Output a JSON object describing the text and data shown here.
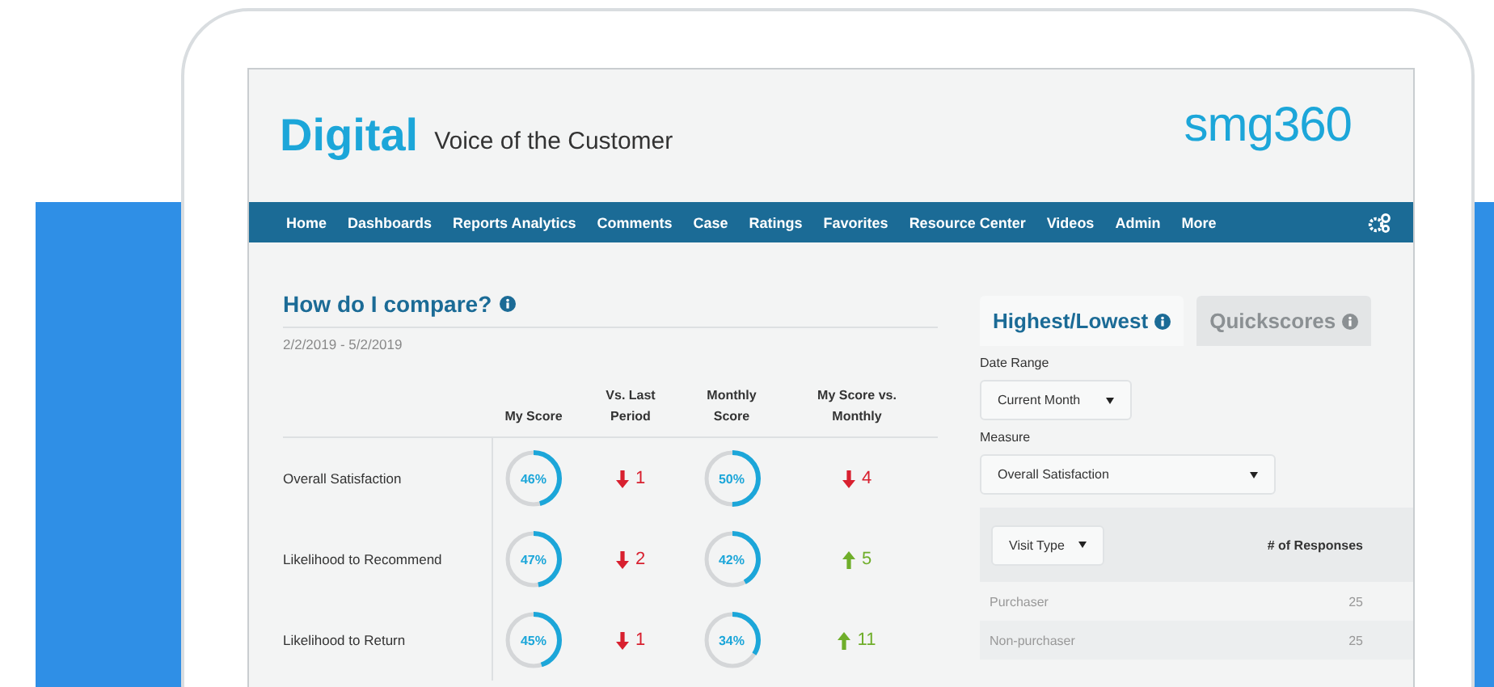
{
  "header": {
    "brand": "Digital",
    "subtitle": "Voice of the Customer",
    "logo": "smg360"
  },
  "nav": {
    "items": [
      "Home",
      "Dashboards",
      "Reports Analytics",
      "Comments",
      "Case",
      "Ratings",
      "Favorites",
      "Resource Center",
      "Videos",
      "Admin",
      "More"
    ]
  },
  "compare": {
    "title": "How do I compare?",
    "date_range": "2/2/2019 - 5/2/2019",
    "columns": [
      "My Score",
      "Vs. Last Period",
      "Monthly Score",
      "My Score vs. Monthly"
    ],
    "rows": [
      {
        "label": "Overall Satisfaction",
        "my_score": {
          "text": "46%",
          "level": 0.46
        },
        "vs_last": {
          "kind": "down",
          "text": "1"
        },
        "monthly": {
          "text": "50%",
          "level": 0.5
        },
        "vs_monthly": {
          "kind": "down",
          "text": "4"
        }
      },
      {
        "label": "Likelihood to Recommend",
        "my_score": {
          "text": "47%",
          "level": 0.47
        },
        "vs_last": {
          "kind": "down",
          "text": "2"
        },
        "monthly": {
          "text": "42%",
          "level": 0.42
        },
        "vs_monthly": {
          "kind": "up",
          "text": "5"
        }
      },
      {
        "label": "Likelihood to Return",
        "my_score": {
          "text": "45%",
          "level": 0.45
        },
        "vs_last": {
          "kind": "down",
          "text": "1"
        },
        "monthly": {
          "text": "34%",
          "level": 0.34
        },
        "vs_monthly": {
          "kind": "up",
          "text": "11"
        }
      }
    ]
  },
  "side": {
    "tabs": [
      {
        "label": "Highest/Lowest",
        "selected": true
      },
      {
        "label": "Quickscores",
        "selected": false
      }
    ],
    "date_range_label": "Date Range",
    "date_range_value": "Current Month",
    "measure_label": "Measure",
    "measure_value": "Overall Satisfaction",
    "table": {
      "filter": "Visit Type",
      "column": "# of Responses",
      "rows": [
        {
          "label": "Purchaser",
          "value": "25"
        },
        {
          "label": "Non-purchaser",
          "value": "25"
        }
      ]
    }
  }
}
